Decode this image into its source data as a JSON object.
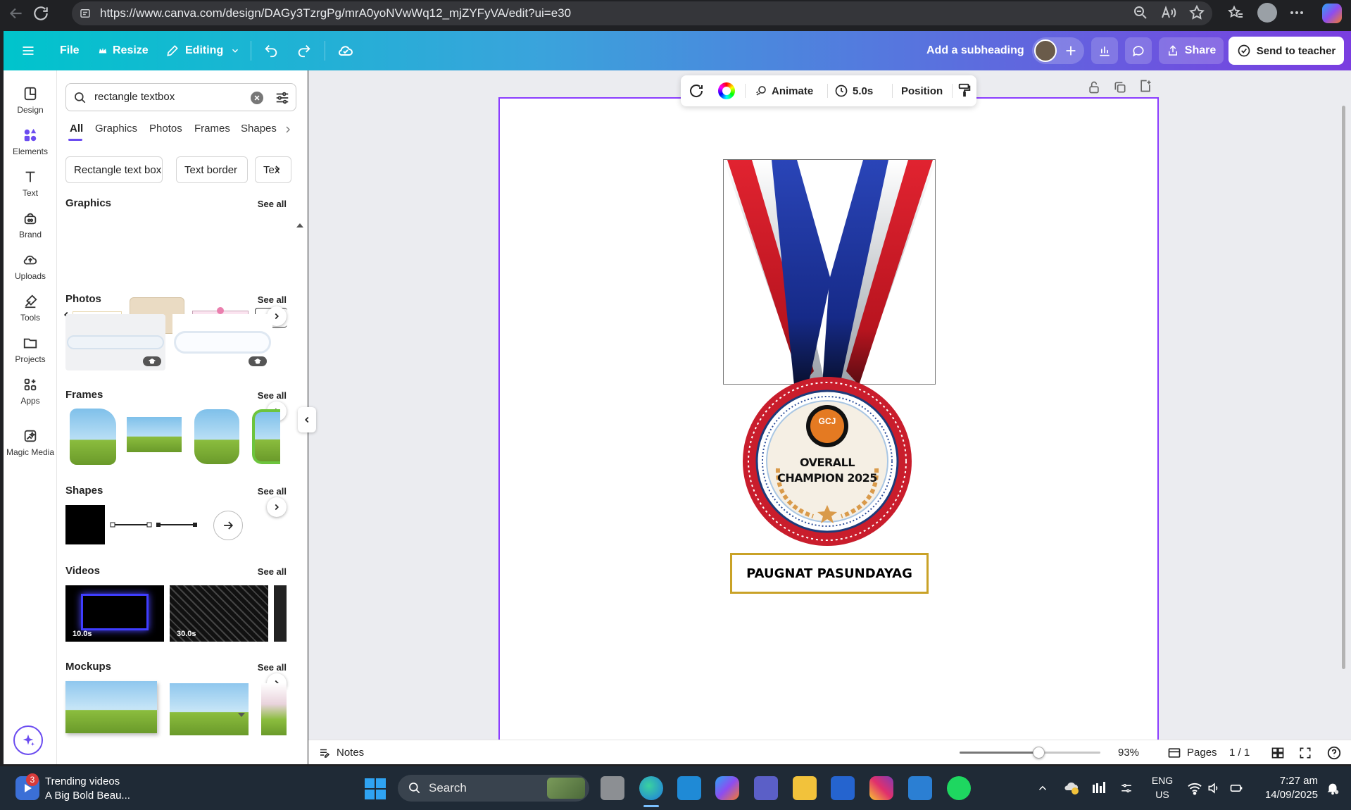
{
  "browser": {
    "url": "https://www.canva.com/design/DAGy3TzrgPg/mrA0yoNVwWq12_mjZYFyVA/edit?ui=e30"
  },
  "header": {
    "file": "File",
    "resize": "Resize",
    "editing": "Editing",
    "subheading": "Add a subheading",
    "share": "Share",
    "send": "Send to teacher"
  },
  "rail": [
    {
      "label": "Design",
      "icon": "design-icon"
    },
    {
      "label": "Elements",
      "icon": "elements-icon"
    },
    {
      "label": "Text",
      "icon": "text-icon"
    },
    {
      "label": "Brand",
      "icon": "brand-icon"
    },
    {
      "label": "Uploads",
      "icon": "uploads-icon"
    },
    {
      "label": "Tools",
      "icon": "tools-icon"
    },
    {
      "label": "Projects",
      "icon": "projects-icon"
    },
    {
      "label": "Apps",
      "icon": "apps-icon"
    },
    {
      "label": "Magic Media",
      "icon": "magic-media-icon"
    }
  ],
  "panel": {
    "search_value": "rectangle textbox",
    "tabs": [
      "All",
      "Graphics",
      "Photos",
      "Frames",
      "Shapes"
    ],
    "chips": [
      "Rectangle text box",
      "Text border",
      "Tex"
    ],
    "see_all": "See all",
    "sections": {
      "graphics": "Graphics",
      "photos": "Photos",
      "frames": "Frames",
      "shapes": "Shapes",
      "videos": "Videos",
      "mockups": "Mockups"
    },
    "videos": [
      "10.0s",
      "30.0s"
    ]
  },
  "toolbar": {
    "animate": "Animate",
    "duration": "5.0s",
    "position": "Position"
  },
  "canvas": {
    "medal_line1": "OVERALL",
    "medal_line2": "CHAMPION 2025",
    "logo_text": "GCJ",
    "name_box": "PAUGNAT PASUNDAYAG",
    "colors": {
      "accent": "#8b3dff",
      "ribbon_red": "#d91f2a",
      "ribbon_blue": "#1a2d8f",
      "gold": "#c9a227"
    }
  },
  "footer": {
    "notes": "Notes",
    "zoom": "93%",
    "pages": "Pages",
    "page_count": "1 / 1"
  },
  "taskbar": {
    "notif_count": "3",
    "trend_title": "Trending videos",
    "trend_sub": "A Big Bold Beau...",
    "search": "Search",
    "lang1": "ENG",
    "lang2": "US",
    "time": "7:27 am",
    "date": "14/09/2025"
  }
}
